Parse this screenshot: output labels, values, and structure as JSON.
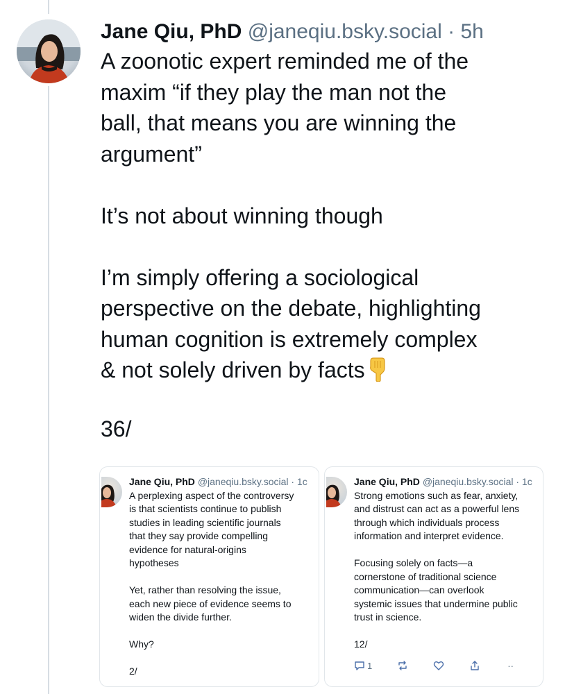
{
  "post": {
    "author_name": "Jane Qiu, PhD",
    "handle": "@janeqiu.bsky.social",
    "separator": "·",
    "time": "5h",
    "paragraphs": [
      [
        "A zoonotic expert reminded me of the",
        "maxim “if they play the man not the",
        "ball, that means you are winning the",
        "argument”"
      ],
      [
        "It’s not about winning though"
      ],
      [
        "I’m simply offering a sociological",
        "perspective on the debate, highlighting",
        "human cognition is extremely complex",
        "& not solely driven by facts"
      ]
    ],
    "emoji": "pointing-down-hand",
    "counter": "36/"
  },
  "quoted_left": {
    "author_name": "Jane Qiu, PhD",
    "handle": "@janeqiu.bsky.social · 1c",
    "paragraphs": [
      [
        "A perplexing aspect of the controversy",
        "is that scientists continue to publish",
        "studies in leading scientific journals",
        "that they say provide compelling",
        "evidence for natural-origins",
        "hypotheses"
      ],
      [
        "Yet, rather than resolving the issue,",
        "each new piece of evidence seems to",
        "widen the divide further."
      ],
      [
        "Why?"
      ],
      [
        "2/"
      ]
    ]
  },
  "quoted_right": {
    "author_name": "Jane Qiu, PhD",
    "handle": "@janeqiu.bsky.social · 1c",
    "paragraphs": [
      [
        "Strong emotions such as fear, anxiety,",
        "and distrust can act as a powerful lens",
        "through which individuals process",
        "information and interpret evidence."
      ],
      [
        "Focusing solely on facts—a",
        "cornerstone of traditional science",
        "communication—can overlook",
        "systemic issues that undermine public",
        "trust in science."
      ],
      [
        "12/"
      ]
    ],
    "actions": {
      "reply_count": "1",
      "reply_icon": "reply-icon",
      "repost_icon": "repost-icon",
      "like_icon": "heart-icon",
      "share_icon": "share-icon",
      "more": "··"
    }
  }
}
